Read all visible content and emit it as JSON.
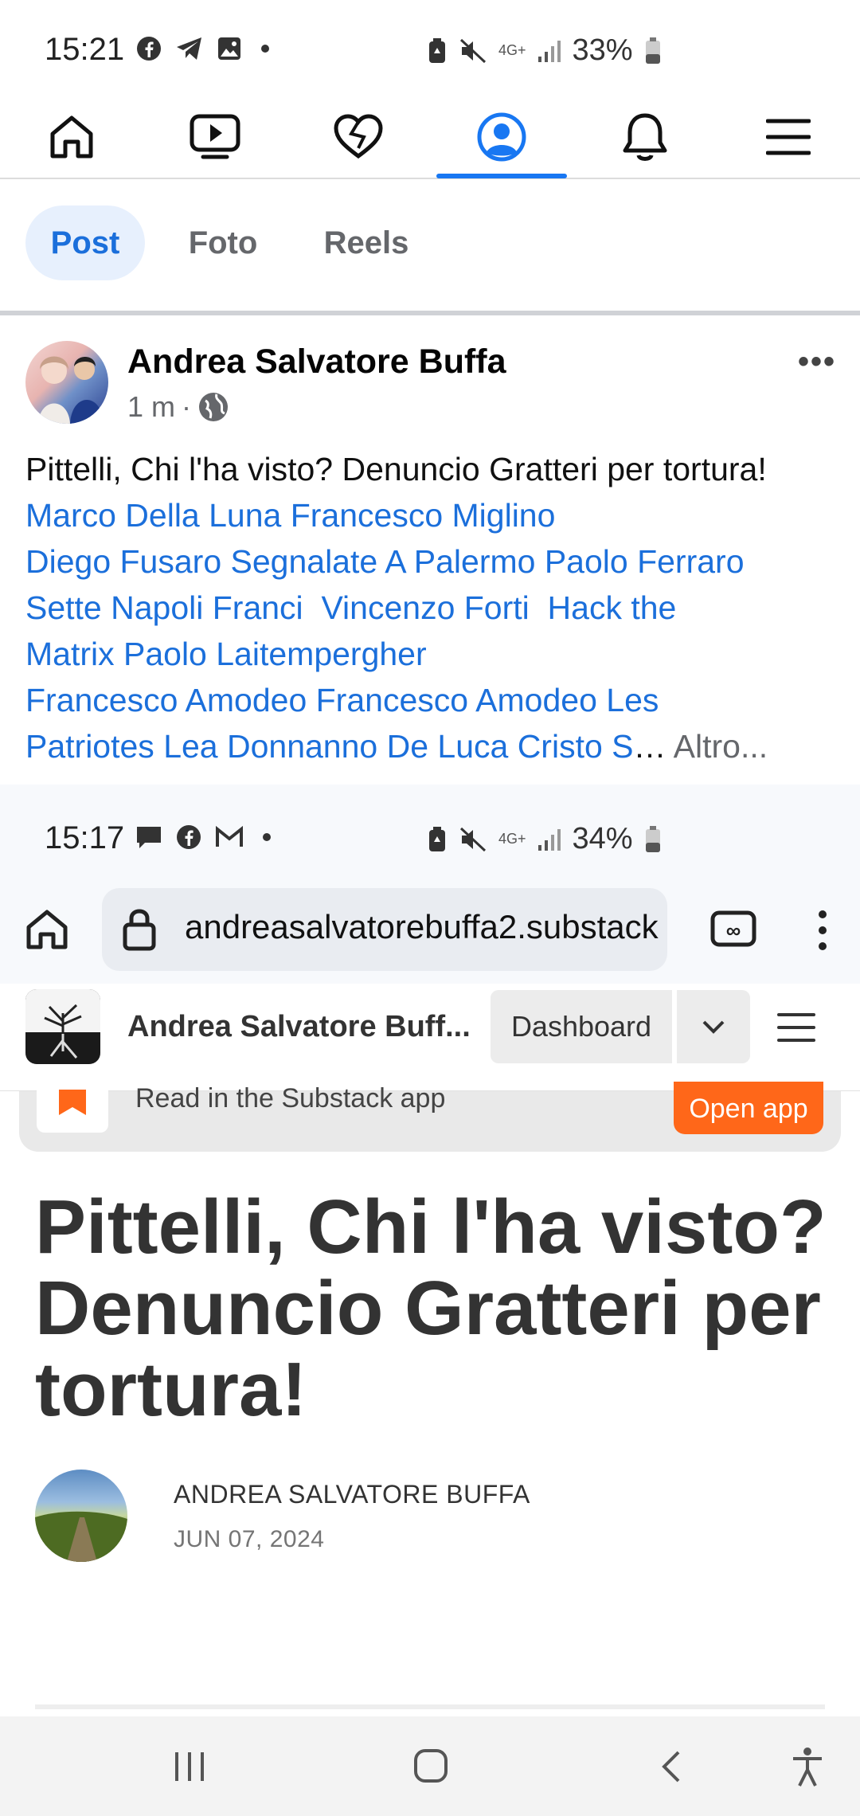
{
  "status_bar_1": {
    "time": "15:21",
    "battery": "33%",
    "network": "4G+"
  },
  "fb_nav": {
    "items": [
      "home-icon",
      "video-icon",
      "dating-heart-icon",
      "profile-icon",
      "bell-icon",
      "menu-icon"
    ],
    "active_index": 3,
    "accent": "#1877f2"
  },
  "filter_tabs": [
    {
      "label": "Post",
      "active": true
    },
    {
      "label": "Foto",
      "active": false
    },
    {
      "label": "Reels",
      "active": false
    }
  ],
  "post": {
    "author": "Andrea Salvatore Buffa",
    "time": "1 m",
    "dot": "·",
    "text_plain": "Pittelli, Chi l'ha visto? Denuncio Gratteri per tortura!",
    "links_1": "Marco Della Luna Francesco Miglino",
    "links_2": "Diego Fusaro Segnalate A Palermo Paolo Ferraro",
    "links_3": "Sette Napoli Franci  Vincenzo Forti  Hack the",
    "links_4": "Matrix Paolo Laitempergher",
    "links_5": "Francesco Amodeo Francesco Amodeo Les",
    "links_6": "Patriotes Lea Donnanno De Luca Cristo S",
    "ellipsis": "…",
    "more_label": "Altro..."
  },
  "status_bar_2": {
    "time": "15:17",
    "battery": "34%",
    "network": "4G+"
  },
  "browser": {
    "url": "andreasalvatorebuffa2.substack"
  },
  "substack": {
    "publication": "Andrea Salvatore Buff...",
    "dashboard_label": "Dashboard",
    "banner_text": "Read in the Substack app",
    "open_app_label": "Open app",
    "article_title": "Pittelli, Chi l'ha visto? Denuncio Gratteri per tortura!",
    "article_author": "ANDREA SALVATORE BUFFA",
    "article_date": "JUN 07, 2024",
    "accent": "#ff6719"
  }
}
